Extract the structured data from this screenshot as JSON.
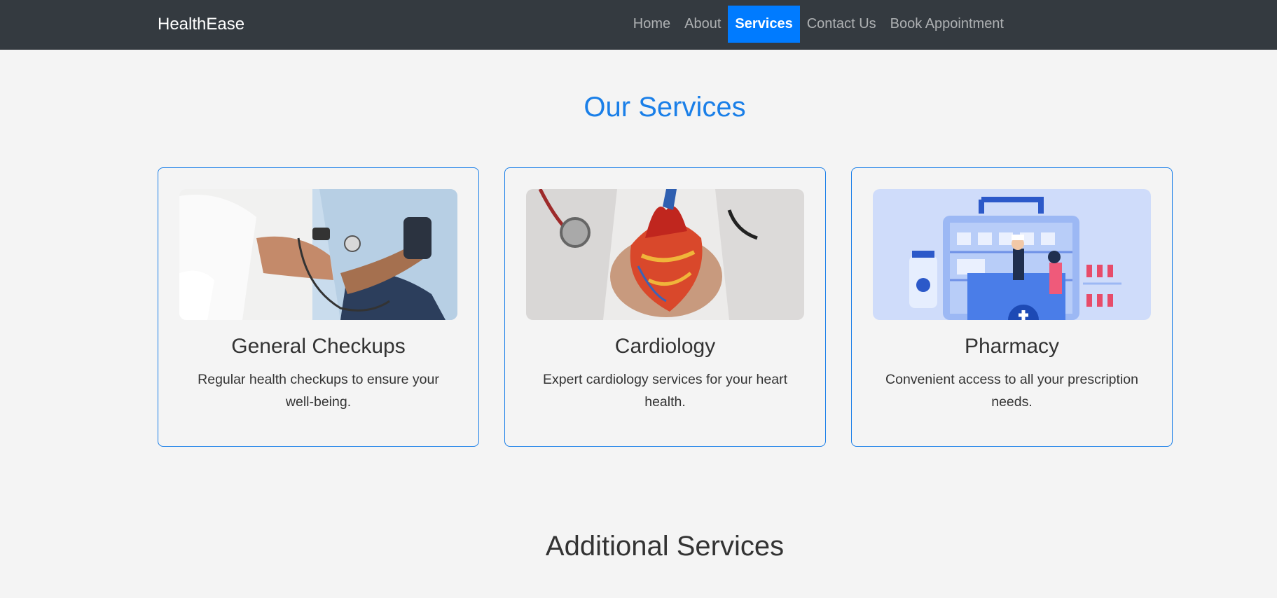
{
  "navbar": {
    "brand": "HealthEase",
    "links": [
      {
        "label": "Home",
        "active": false
      },
      {
        "label": "About",
        "active": false
      },
      {
        "label": "Services",
        "active": true
      },
      {
        "label": "Contact Us",
        "active": false
      },
      {
        "label": "Book Appointment",
        "active": false
      }
    ]
  },
  "main": {
    "title": "Our Services",
    "cards": [
      {
        "title": "General Checkups",
        "text": "Regular health checkups to ensure your well-being.",
        "image": "blood-pressure-check-photo"
      },
      {
        "title": "Cardiology",
        "text": "Expert cardiology services for your heart health.",
        "image": "heart-model-photo"
      },
      {
        "title": "Pharmacy",
        "text": "Convenient access to all your prescription needs.",
        "image": "pharmacy-illustration"
      }
    ]
  },
  "additional": {
    "title": "Additional Services"
  },
  "colors": {
    "navbar_bg": "#343a40",
    "accent": "#007bff",
    "heading_blue": "#1a7fe8",
    "page_bg": "#f4f4f4"
  }
}
